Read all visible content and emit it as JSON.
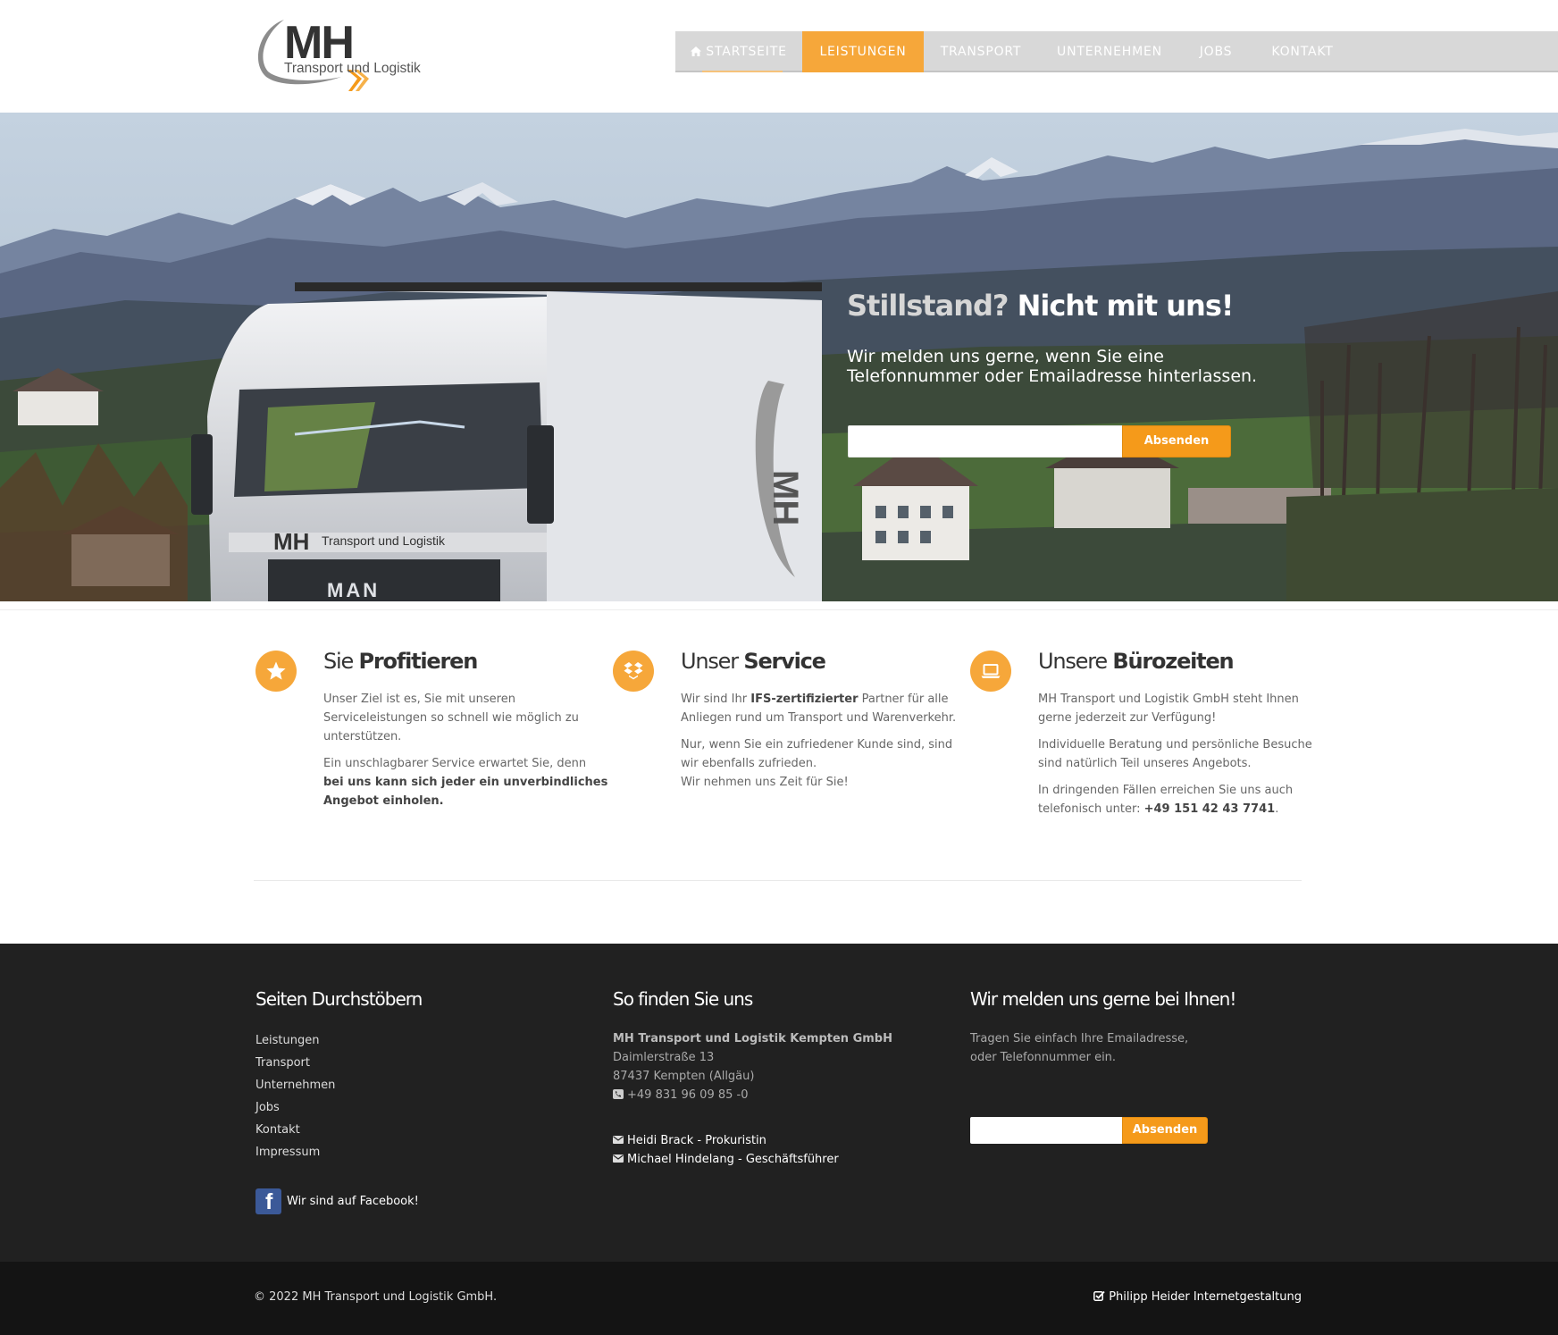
{
  "logo": {
    "title": "MH",
    "subtitle": "Transport und Logistik"
  },
  "nav": {
    "items": [
      {
        "label": "STARTSEITE",
        "icon": "home-icon"
      },
      {
        "label": "LEISTUNGEN",
        "active": true
      },
      {
        "label": "TRANSPORT"
      },
      {
        "label": "UNTERNEHMEN"
      },
      {
        "label": "JOBS"
      },
      {
        "label": "KONTAKT"
      }
    ]
  },
  "hero": {
    "headline_light": "Stillstand?",
    "headline_bold": "Nicht mit uns!",
    "subline": "Wir melden uns gerne, wenn Sie eine Telefonnummer oder Emailadresse hinterlassen.",
    "input_value": "",
    "button_label": "Absenden",
    "truck_brand": "MAN",
    "truck_cab_text": "Transport und Logistik",
    "truck_logo": "MH"
  },
  "features": [
    {
      "icon": "star-icon",
      "title_light": "Sie",
      "title_bold": "Profitieren",
      "p1": "Unser Ziel ist es, Sie mit unseren Serviceleistungen so schnell wie möglich zu unterstützen.",
      "p2_plain": "Ein unschlagbarer Service erwartet Sie, denn",
      "p2_bold": "bei uns kann sich jeder ein unverbindliches Angebot einholen."
    },
    {
      "icon": "dropbox-icon",
      "title_light": "Unser",
      "title_bold": "Service",
      "p1_pre": "Wir sind Ihr",
      "p1_bold": "IFS-zertifizierter",
      "p1_post": "Partner für alle Anliegen rund um Transport und Warenverkehr.",
      "p2": "Nur, wenn Sie ein zufriedener Kunde sind, sind wir ebenfalls zufrieden.",
      "p3": "Wir nehmen uns Zeit für Sie!"
    },
    {
      "icon": "laptop-icon",
      "title_light": "Unsere",
      "title_bold": "Bürozeiten",
      "p1": "MH Transport und Logistik GmbH steht Ihnen gerne jederzeit zur Verfügung!",
      "p2": "Individuelle Beratung und persönliche Besuche sind natürlich Teil unseres Angebots.",
      "p3_pre": "In dringenden Fällen erreichen Sie uns auch telefonisch unter:",
      "p3_bold": "+49 151 42 43 7741",
      "p3_post": "."
    }
  ],
  "footer": {
    "col1": {
      "heading": "Seiten Durchstöbern",
      "links": [
        "Leistungen",
        "Transport",
        "Unternehmen",
        "Jobs",
        "Kontakt",
        "Impressum"
      ],
      "facebook_label": "Wir sind auf Facebook!"
    },
    "col2": {
      "heading": "So finden Sie uns",
      "company": "MH Transport und Logistik Kempten GmbH",
      "street": "Daimlerstraße 13",
      "city": "87437 Kempten (Allgäu)",
      "phone": "+49 831 96 09 85 -0",
      "contacts": [
        "Heidi Brack - Prokuristin",
        "Michael Hindelang - Geschäftsführer"
      ]
    },
    "col3": {
      "heading": "Wir melden uns gerne bei Ihnen!",
      "text": "Tragen Sie einfach Ihre Emailadresse, oder Telefonnummer ein.",
      "input_value": "",
      "button_label": "Absenden"
    }
  },
  "bottom": {
    "copyright": "© 2022 MH Transport und Logistik GmbH.",
    "credit": "Philipp Heider Internetgestaltung"
  },
  "colors": {
    "accent": "#f6a73a",
    "button": "#f59a1a",
    "footer_bg": "#212121",
    "bottom_bg": "#141414"
  }
}
